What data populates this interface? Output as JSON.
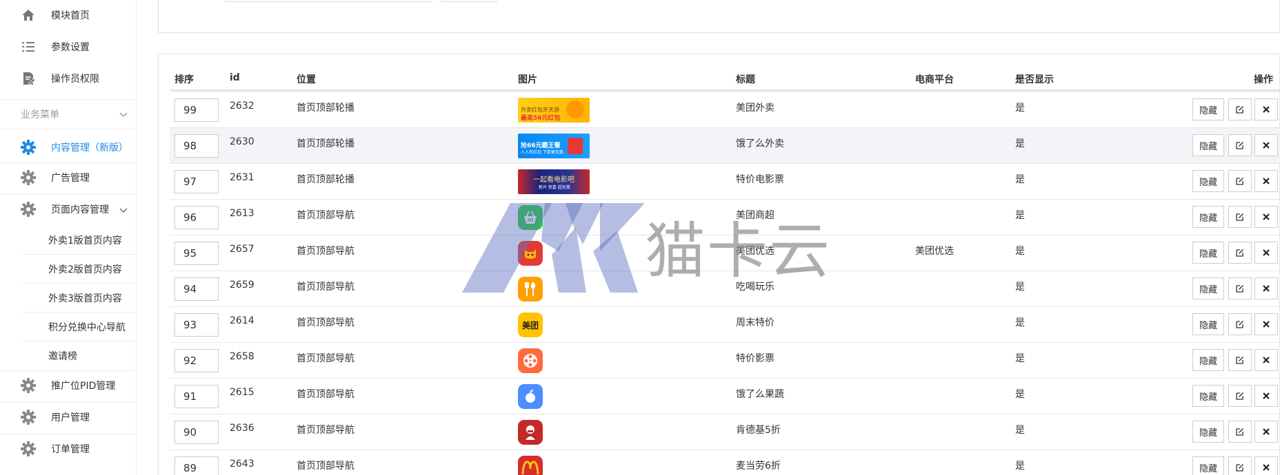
{
  "sidebar": {
    "top_items": [
      {
        "label": "模块首页",
        "icon": "home-icon"
      },
      {
        "label": "参数设置",
        "icon": "list-settings-icon"
      },
      {
        "label": "操作员权限",
        "icon": "edit-document-icon"
      }
    ],
    "section_title": "业务菜单",
    "items": [
      {
        "label": "内容管理（新版）",
        "icon": "gear-icon",
        "active": true
      },
      {
        "label": "广告管理",
        "icon": "gear-icon"
      },
      {
        "label": "页面内容管理",
        "icon": "gear-icon"
      }
    ],
    "sub_items": [
      "外卖1版首页内容",
      "外卖2版首页内容",
      "外卖3版首页内容",
      "积分兑换中心导航",
      "邀请榜"
    ],
    "bottom_items": [
      {
        "label": "推广位PID管理",
        "icon": "gear-icon"
      },
      {
        "label": "用户管理",
        "icon": "gear-icon"
      },
      {
        "label": "订单管理",
        "icon": "gear-icon"
      }
    ]
  },
  "table": {
    "headers": {
      "sort": "排序",
      "id": "id",
      "position": "位置",
      "image": "图片",
      "title": "标题",
      "platform": "电商平台",
      "visible": "是否显示",
      "actions": "操作"
    },
    "rows": [
      {
        "sort": "99",
        "id": "2632",
        "position": "首页顶部轮播",
        "image": "banner-meituan-waimai",
        "title": "美团外卖",
        "platform": "",
        "visible": "是"
      },
      {
        "sort": "98",
        "id": "2630",
        "position": "首页顶部轮播",
        "image": "banner-eleme",
        "title": "饿了么外卖",
        "platform": "",
        "visible": "是"
      },
      {
        "sort": "97",
        "id": "2631",
        "position": "首页顶部轮播",
        "image": "banner-movie",
        "title": "特价电影票",
        "platform": "",
        "visible": "是"
      },
      {
        "sort": "96",
        "id": "2613",
        "position": "首页顶部导航",
        "image": "basket-icon",
        "title": "美团商超",
        "platform": "",
        "visible": "是"
      },
      {
        "sort": "95",
        "id": "2657",
        "position": "首页顶部导航",
        "image": "cat-icon",
        "title": "美团优选",
        "platform": "美团优选",
        "visible": "是"
      },
      {
        "sort": "94",
        "id": "2659",
        "position": "首页顶部导航",
        "image": "fork-spoon-icon",
        "title": "吃喝玩乐",
        "platform": "",
        "visible": "是"
      },
      {
        "sort": "93",
        "id": "2614",
        "position": "首页顶部导航",
        "image": "meituan-icon",
        "title": "周末特价",
        "platform": "",
        "visible": "是"
      },
      {
        "sort": "92",
        "id": "2658",
        "position": "首页顶部导航",
        "image": "film-reel-icon",
        "title": "特价影票",
        "platform": "",
        "visible": "是"
      },
      {
        "sort": "91",
        "id": "2615",
        "position": "首页顶部导航",
        "image": "fruit-icon",
        "title": "饿了么果蔬",
        "platform": "",
        "visible": "是"
      },
      {
        "sort": "90",
        "id": "2636",
        "position": "首页顶部导航",
        "image": "kfc-icon",
        "title": "肯德基5折",
        "platform": "",
        "visible": "是"
      },
      {
        "sort": "89",
        "id": "2643",
        "position": "首页顶部导航",
        "image": "mcdonalds-icon",
        "title": "麦当劳6折",
        "platform": "",
        "visible": "是"
      }
    ],
    "actions": {
      "hide": "隐藏",
      "edit_icon": "edit-icon",
      "delete_icon": "close-icon"
    }
  },
  "banners": {
    "meituan": {
      "line1": "外卖红包天天领",
      "line2": "最高56元红包"
    },
    "eleme": {
      "line1": "抢66元霸王餐",
      "line2": "人人有红包 下单更优惠"
    },
    "movie": {
      "line1": "一起看电影吧",
      "line2": "新片 惊喜 超优惠"
    }
  },
  "app_icons": {
    "meituan": "美团"
  },
  "watermark": {
    "text": "猫卡云",
    "logo": "MK"
  },
  "colors": {
    "accent": "#1e88e5",
    "meituan_yellow": "#ffc300",
    "eleme_blue": "#0a86f0"
  }
}
